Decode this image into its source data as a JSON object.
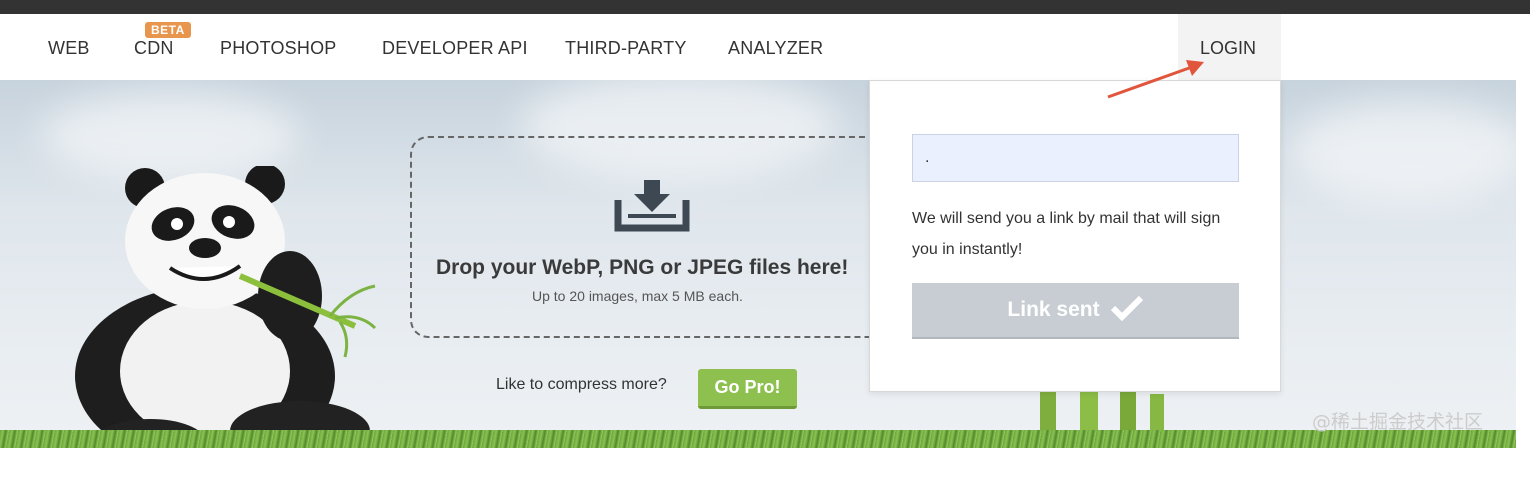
{
  "nav": {
    "items": [
      "WEB",
      "CDN",
      "PHOTOSHOP",
      "DEVELOPER API",
      "THIRD-PARTY",
      "ANALYZER"
    ],
    "beta_badge": "BETA",
    "login": "LOGIN"
  },
  "dropzone": {
    "title": "Drop your WebP, PNG or JPEG files here!",
    "subtitle": "Up to 20 images, max 5 MB each.",
    "icon": "download-tray-icon"
  },
  "promo": {
    "text": "Like to compress more?",
    "button": "Go Pro!"
  },
  "login_panel": {
    "email_value": ".",
    "message": "We will send you a link by mail that will sign you in instantly!",
    "button": "Link sent",
    "button_icon": "checkmark-icon"
  },
  "watermark": "@稀土掘金技术社区",
  "colors": {
    "topbar": "#333333",
    "beta": "#e8964e",
    "gopro": "#8dc04f",
    "link_sent": "#c7cdd2",
    "arrow": "#e0553b"
  }
}
